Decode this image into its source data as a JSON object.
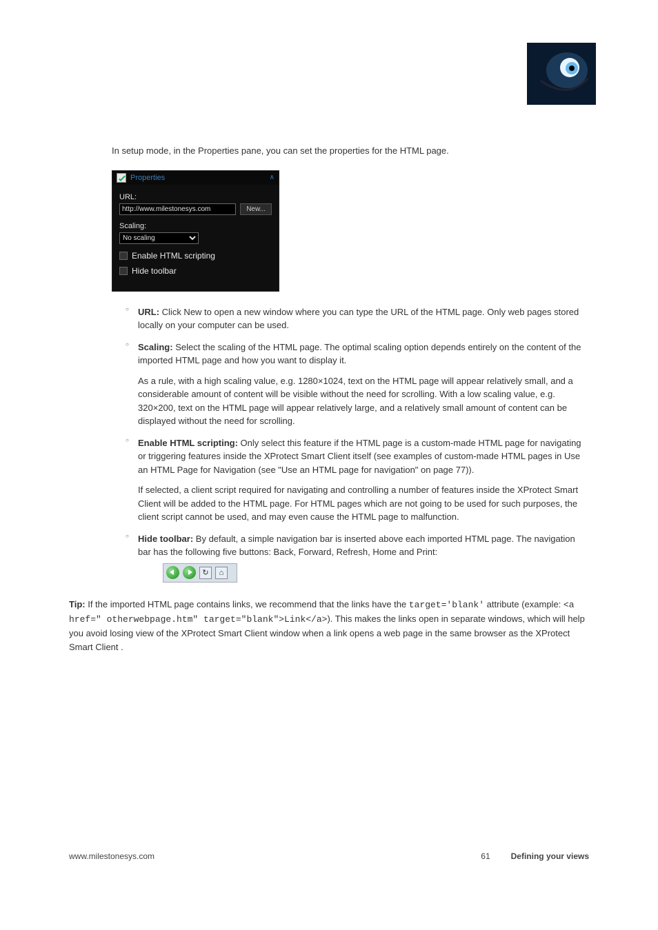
{
  "logo_alt": "wolf-eye-logo",
  "intro": "In setup mode, in the Properties pane, you can set the properties for the HTML page.",
  "panel": {
    "header": "Properties",
    "url_label": "URL:",
    "url_value": "http://www.milestonesys.com",
    "new_button": "New...",
    "scaling_label": "Scaling:",
    "scaling_value": "No scaling",
    "enable_scripting": "Enable HTML scripting",
    "hide_toolbar": "Hide toolbar"
  },
  "bullets": {
    "url": {
      "label": "URL:",
      "text": " Click New to open a new window where you can type the URL of the HTML page. Only web pages stored locally on your computer can be used."
    },
    "scaling": {
      "label": "Scaling:",
      "text": " Select the scaling of the HTML page. The optimal scaling option depends entirely on the content of the imported HTML page and how you want to display it.",
      "text2": "As a rule, with a high scaling value, e.g. 1280×1024, text on the HTML page will appear relatively small, and a considerable amount of content will be visible without the need for scrolling. With a low scaling value, e.g. 320×200, text on the HTML page will appear relatively large, and a relatively small amount of content can be displayed without the need for scrolling."
    },
    "enable": {
      "label": "Enable HTML scripting:",
      "text": " Only select this feature if the HTML page is a custom-made HTML page for navigating or triggering features inside the XProtect Smart Client itself (see examples of custom-made HTML pages in Use an HTML Page for Navigation (see \"Use an HTML page for navigation\" on page 77)).",
      "text2": "If selected, a client script required for navigating and controlling a number of features inside the XProtect Smart Client will be added to the HTML page. For HTML pages which are not going to be used for such purposes, the client script cannot be used, and may even cause the HTML page to malfunction."
    },
    "hide": {
      "label": "Hide toolbar:",
      "text": " By default, a simple navigation bar is inserted above each imported HTML page. The navigation bar has the following five buttons: Back, Forward, Refresh, Home and Print:"
    }
  },
  "tip": {
    "label": "Tip:",
    "text_before": " If the imported HTML page contains links, we recommend that the links have the ",
    "code1": "target='blank'",
    "text_mid": " attribute (example: ",
    "code2": "<a href=\" otherwebpage.htm\" target=\"blank\">Link</a>",
    "text_after": "). This makes the links open in separate windows, which will help you avoid losing view of the XProtect Smart Client window when a link opens a web page in the same browser as the XProtect Smart Client ."
  },
  "footer": {
    "doc": "www.milestonesys.com",
    "page": "61",
    "section": "Defining your views"
  }
}
